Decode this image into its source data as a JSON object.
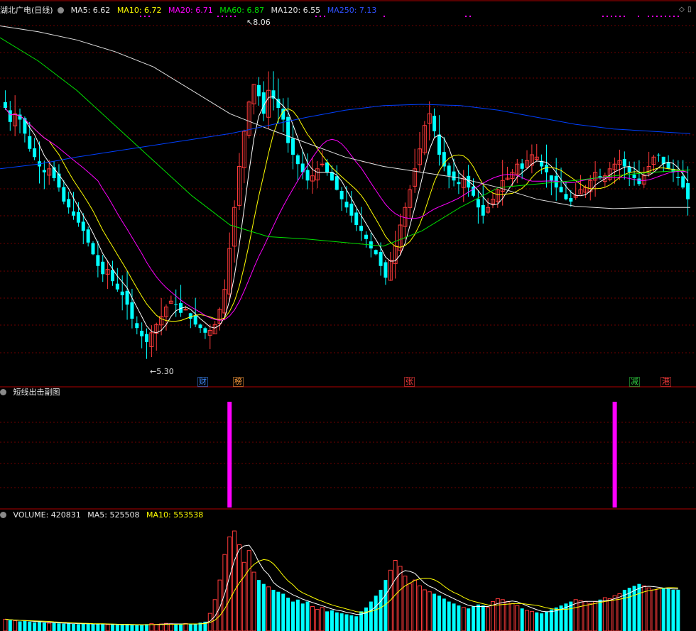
{
  "main_header": {
    "title": "湖北广电(日线)",
    "ma5": "MA5: 6.62",
    "ma10": "MA10: 6.72",
    "ma20": "MA20: 6.71",
    "ma60": "MA60: 6.87",
    "ma120": "MA120: 6.55",
    "ma250": "MA250: 7.13"
  },
  "sub_header": {
    "title": "短线出击副图"
  },
  "vol_header": {
    "volume": "VOLUME: 420831",
    "ma5": "MA5: 525508",
    "ma10": "MA10: 553538"
  },
  "annotations": {
    "high": "8.06",
    "low": "5.30"
  },
  "events": [
    {
      "label": "财",
      "color": "#3d8bff"
    },
    {
      "label": "榜",
      "color": "#ff9d3d"
    },
    {
      "label": "张",
      "color": "#ff3d3d"
    },
    {
      "label": "减",
      "color": "#2ecc40"
    },
    {
      "label": "港",
      "color": "#ff3d3d"
    }
  ],
  "colors": {
    "up": "#ff3a3a",
    "down": "#00ffff",
    "ma5": "#ffffff",
    "ma10": "#ffff00",
    "ma20": "#ff00ff",
    "ma60": "#00e000",
    "ma120": "#e0e0e0",
    "ma250": "#0040ff",
    "signal": "#ff00ff",
    "grid": "#6e0000"
  },
  "chart_data": [
    {
      "type": "candlestick",
      "title": "湖北广电(日线)",
      "ylim": [
        5.2,
        8.2
      ],
      "high": 8.06,
      "low": 5.3,
      "last": {
        "MA5": 6.62,
        "MA10": 6.72,
        "MA20": 6.71,
        "MA60": 6.87,
        "MA120": 6.55,
        "MA250": 7.13
      },
      "closes": [
        7.4,
        7.28,
        7.35,
        7.3,
        7.18,
        7.05,
        6.98,
        6.9,
        6.85,
        6.88,
        6.8,
        6.72,
        6.6,
        6.55,
        6.48,
        6.42,
        6.35,
        6.25,
        6.15,
        6.05,
        5.98,
        6.02,
        5.92,
        5.85,
        5.8,
        5.72,
        5.6,
        5.52,
        5.45,
        5.4,
        5.48,
        5.55,
        5.62,
        5.7,
        5.75,
        5.72,
        5.65,
        5.68,
        5.6,
        5.55,
        5.52,
        5.48,
        5.5,
        5.55,
        5.68,
        5.85,
        6.2,
        6.55,
        6.9,
        7.2,
        7.45,
        7.6,
        7.5,
        7.35,
        7.55,
        7.48,
        7.4,
        7.3,
        7.1,
        7.0,
        6.92,
        6.85,
        6.78,
        6.82,
        6.88,
        6.92,
        6.85,
        6.78,
        6.7,
        6.62,
        6.55,
        6.48,
        6.4,
        6.35,
        6.28,
        6.2,
        6.15,
        6.05,
        5.95,
        6.1,
        6.22,
        6.4,
        6.55,
        6.7,
        6.88,
        7.05,
        7.25,
        7.35,
        7.2,
        7.0,
        6.9,
        6.82,
        6.78,
        6.75,
        6.8,
        6.72,
        6.65,
        6.55,
        6.48,
        6.55,
        6.62,
        6.7,
        6.78,
        6.8,
        6.85,
        6.92,
        6.88,
        6.95,
        7.0,
        6.98,
        6.9,
        6.85,
        6.78,
        6.72,
        6.68,
        6.62,
        6.6,
        6.65,
        6.7,
        6.72,
        6.78,
        6.85,
        6.8,
        6.82,
        6.88,
        6.92,
        6.95,
        6.9,
        6.85,
        6.8,
        6.75,
        6.82,
        6.9,
        6.98,
        7.0,
        6.92,
        6.88,
        6.85,
        6.8,
        6.72,
        6.62
      ],
      "ma250_path": [
        6.88,
        6.92,
        6.98,
        7.03,
        7.08,
        7.13,
        7.18,
        7.25,
        7.32,
        7.38,
        7.42,
        7.43,
        7.42,
        7.38,
        7.32,
        7.26,
        7.22,
        7.2,
        7.18
      ],
      "ma120_path": [
        8.1,
        8.05,
        7.98,
        7.88,
        7.75,
        7.55,
        7.35,
        7.22,
        7.1,
        6.98,
        6.9,
        6.85,
        6.8,
        6.72,
        6.62,
        6.56,
        6.54,
        6.55,
        6.55
      ],
      "ma60_path": [
        8.0,
        7.8,
        7.55,
        7.25,
        6.95,
        6.65,
        6.4,
        6.3,
        6.28,
        6.25,
        6.22,
        6.35,
        6.55,
        6.72,
        6.75,
        6.78,
        6.82,
        6.85,
        6.87
      ]
    },
    {
      "type": "bar",
      "title": "短线出击副图",
      "signals": [
        46,
        125
      ]
    },
    {
      "type": "bar",
      "title": "VOLUME",
      "last": {
        "VOLUME": 420831,
        "MA5": 525508,
        "MA10": 553538
      },
      "volumes": [
        120000,
        110000,
        105000,
        98000,
        102000,
        95000,
        88000,
        92000,
        85000,
        80000,
        82000,
        78000,
        75000,
        80000,
        72000,
        70000,
        76000,
        74000,
        68000,
        72000,
        70000,
        65000,
        66000,
        64000,
        62000,
        68000,
        60000,
        58000,
        62000,
        70000,
        75000,
        68000,
        72000,
        78000,
        74000,
        70000,
        68000,
        76000,
        72000,
        70000,
        85000,
        95000,
        180000,
        320000,
        520000,
        780000,
        960000,
        1020000,
        880000,
        700000,
        820000,
        600000,
        520000,
        480000,
        450000,
        420000,
        400000,
        380000,
        340000,
        300000,
        320000,
        280000,
        300000,
        250000,
        220000,
        240000,
        200000,
        210000,
        190000,
        180000,
        170000,
        160000,
        150000,
        200000,
        240000,
        300000,
        360000,
        420000,
        520000,
        620000,
        720000,
        660000,
        560000,
        480000,
        520000,
        460000,
        420000,
        400000,
        380000,
        360000,
        330000,
        300000,
        280000,
        260000,
        240000,
        230000,
        250000,
        270000,
        260000,
        240000,
        300000,
        330000,
        320000,
        300000,
        280000,
        260000,
        230000,
        210000,
        200000,
        190000,
        180000,
        200000,
        220000,
        240000,
        260000,
        280000,
        300000,
        320000,
        310000,
        300000,
        280000,
        300000,
        320000,
        340000,
        330000,
        360000,
        380000,
        420000,
        440000,
        460000,
        480000,
        460000,
        440000,
        420000,
        430000,
        440000,
        430000,
        421000,
        420831
      ]
    }
  ]
}
